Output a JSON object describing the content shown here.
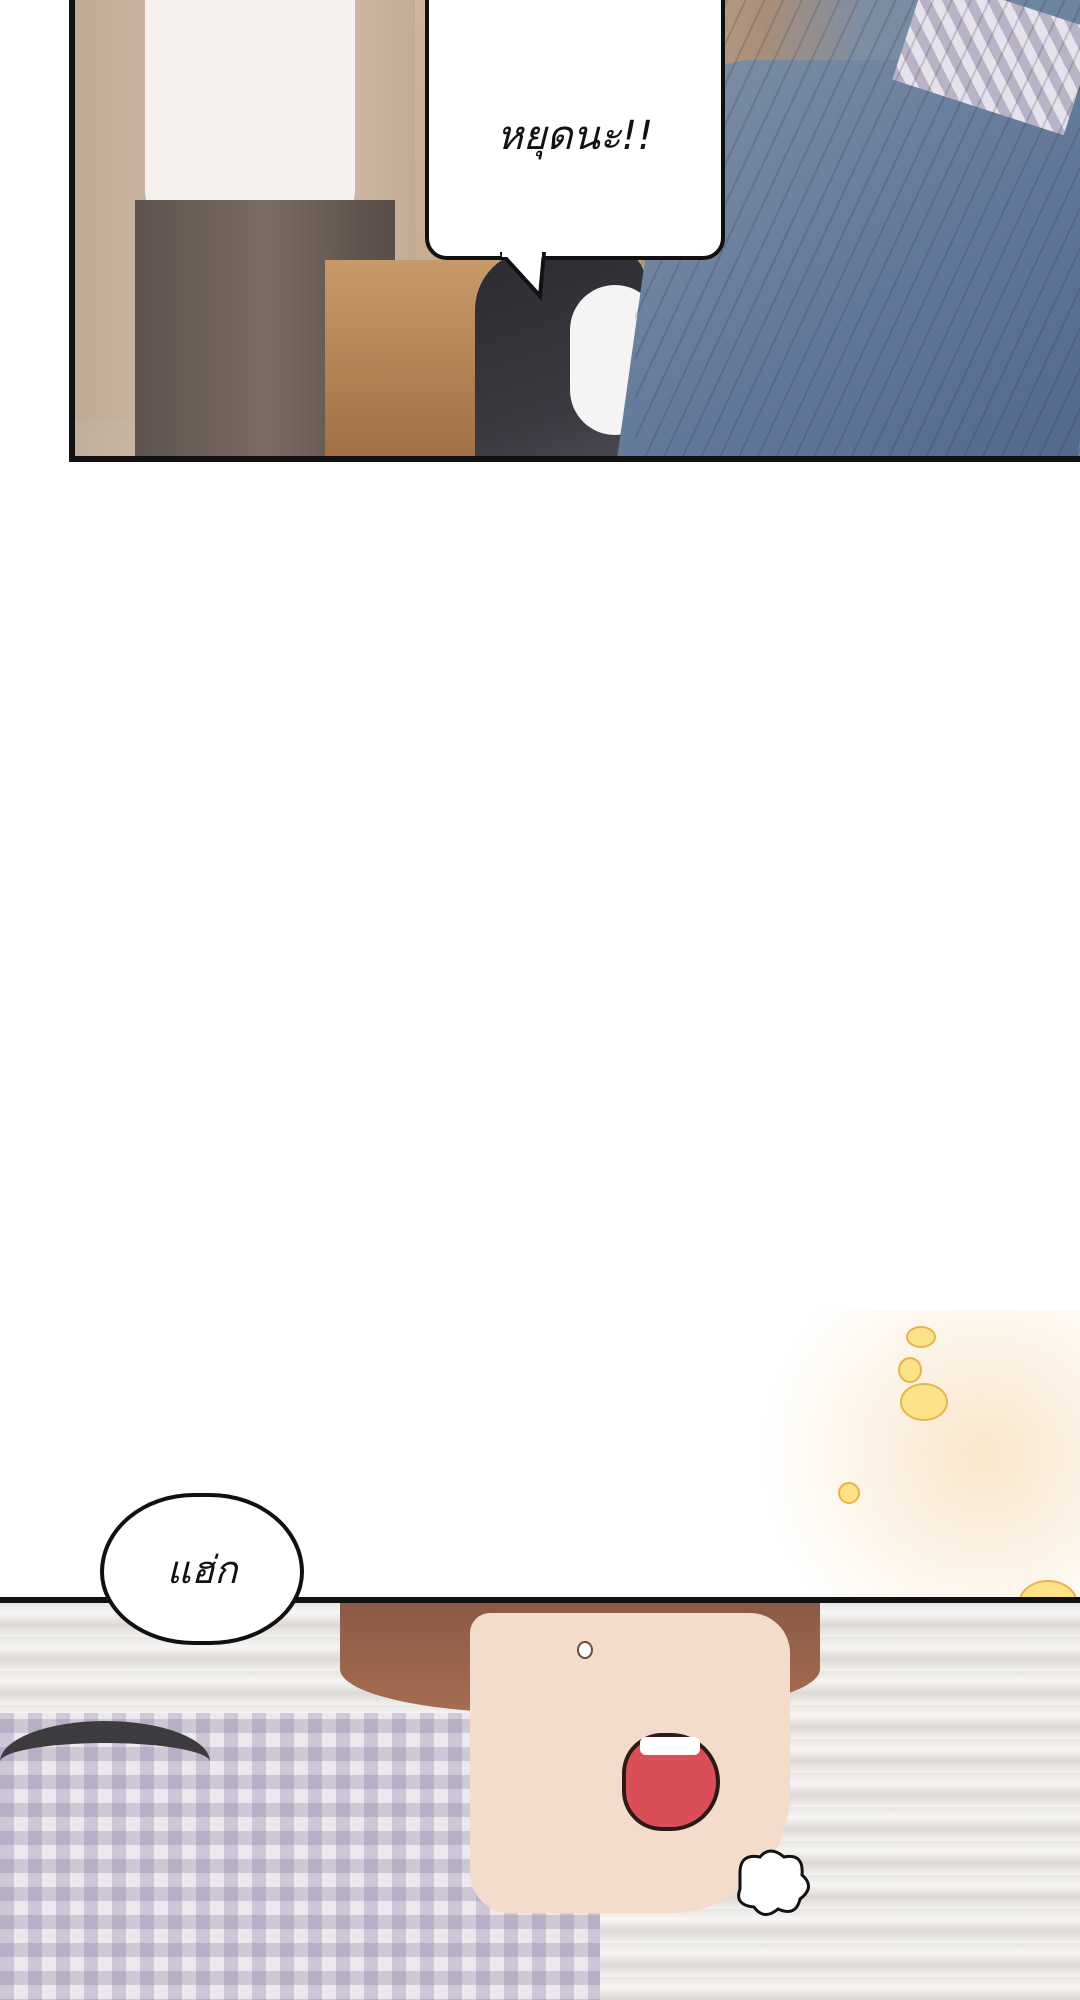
{
  "comic": {
    "panel_top": {
      "speech": "หยุดนะ!!"
    },
    "panel_bottom": {
      "speech": "แฮ่ก"
    }
  }
}
